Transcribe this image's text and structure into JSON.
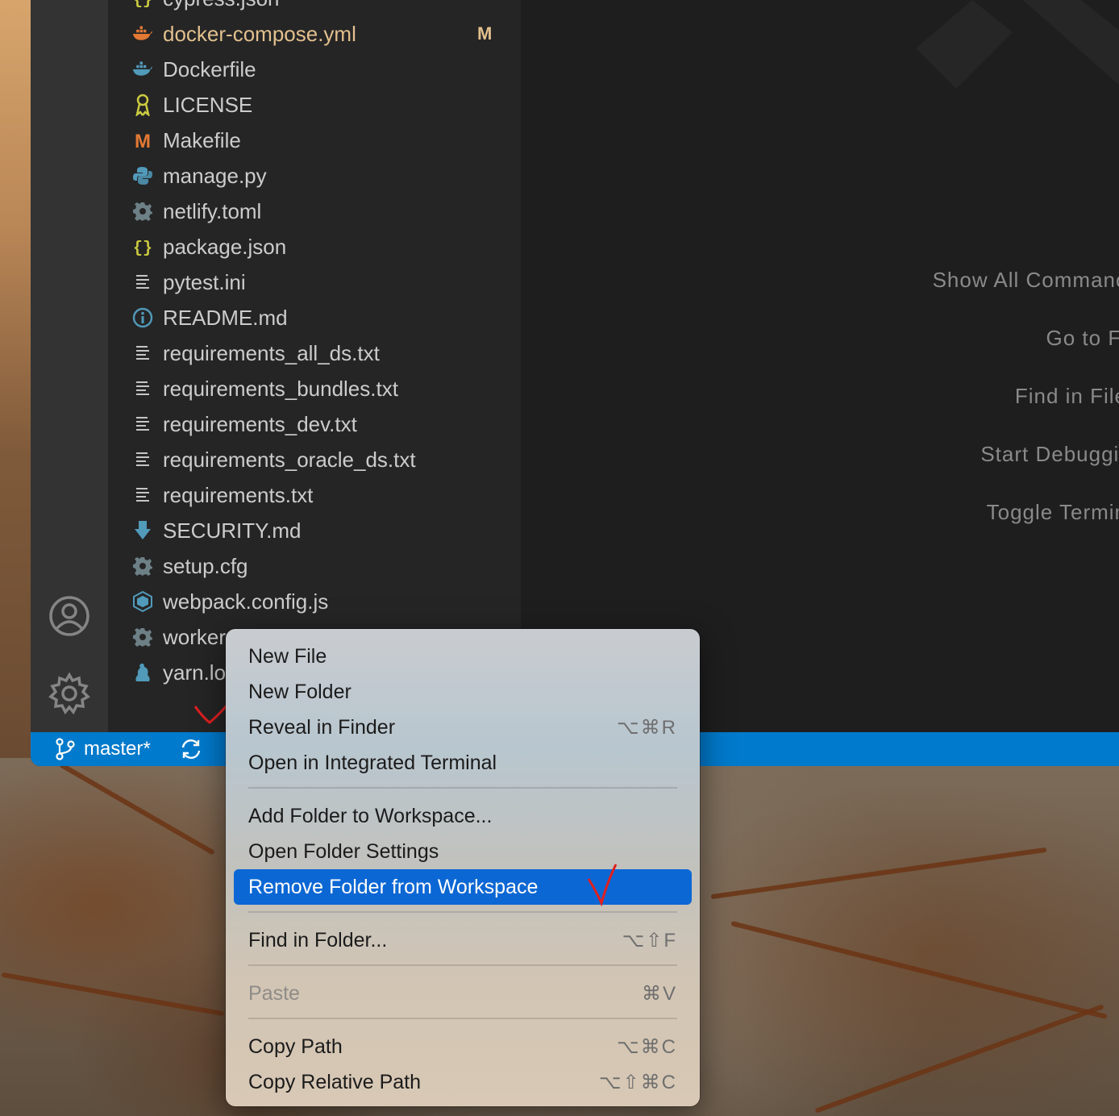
{
  "explorer": {
    "files": [
      {
        "name": "cypress.json",
        "icon": "json-braces-icon",
        "color": "#cbcb41",
        "status": ""
      },
      {
        "name": "docker-compose.yml",
        "icon": "docker-whale-icon",
        "color": "#e37933",
        "status": "M",
        "modified": true
      },
      {
        "name": "Dockerfile",
        "icon": "docker-whale-icon",
        "color": "#519aba",
        "status": ""
      },
      {
        "name": "LICENSE",
        "icon": "license-ribbon-icon",
        "color": "#cbcb41",
        "status": ""
      },
      {
        "name": "Makefile",
        "icon": "makefile-m-icon",
        "color": "#e37933",
        "status": ""
      },
      {
        "name": "manage.py",
        "icon": "python-icon",
        "color": "#519aba",
        "status": ""
      },
      {
        "name": "netlify.toml",
        "icon": "gear-icon",
        "color": "#6d8086",
        "status": ""
      },
      {
        "name": "package.json",
        "icon": "json-braces-icon",
        "color": "#cbcb41",
        "status": ""
      },
      {
        "name": "pytest.ini",
        "icon": "text-lines-icon",
        "color": "#c5c5c5",
        "status": ""
      },
      {
        "name": "README.md",
        "icon": "info-circle-icon",
        "color": "#519aba",
        "status": ""
      },
      {
        "name": "requirements_all_ds.txt",
        "icon": "text-lines-icon",
        "color": "#c5c5c5",
        "status": ""
      },
      {
        "name": "requirements_bundles.txt",
        "icon": "text-lines-icon",
        "color": "#c5c5c5",
        "status": ""
      },
      {
        "name": "requirements_dev.txt",
        "icon": "text-lines-icon",
        "color": "#c5c5c5",
        "status": ""
      },
      {
        "name": "requirements_oracle_ds.txt",
        "icon": "text-lines-icon",
        "color": "#c5c5c5",
        "status": ""
      },
      {
        "name": "requirements.txt",
        "icon": "text-lines-icon",
        "color": "#c5c5c5",
        "status": ""
      },
      {
        "name": "SECURITY.md",
        "icon": "download-arrow-icon",
        "color": "#519aba",
        "status": ""
      },
      {
        "name": "setup.cfg",
        "icon": "gear-icon",
        "color": "#6d8086",
        "status": ""
      },
      {
        "name": "webpack.config.js",
        "icon": "webpack-cube-icon",
        "color": "#519aba",
        "status": ""
      },
      {
        "name": "worker",
        "icon": "gear-icon",
        "color": "#6d8086",
        "status": ""
      },
      {
        "name": "yarn.lo",
        "icon": "yarn-cat-icon",
        "color": "#519aba",
        "status": ""
      }
    ]
  },
  "welcome": {
    "shortcuts": [
      "Show All Commanc",
      "Go to Fi",
      "Find in File",
      "Start Debuggir",
      "Toggle Termin"
    ]
  },
  "statusbar": {
    "branch": "master*"
  },
  "context_menu": {
    "items": [
      {
        "label": "New File",
        "keys": ""
      },
      {
        "label": "New Folder",
        "keys": ""
      },
      {
        "label": "Reveal in Finder",
        "keys": "⌥⌘R"
      },
      {
        "label": "Open in Integrated Terminal",
        "keys": ""
      },
      {
        "label": "Add Folder to Workspace...",
        "keys": ""
      },
      {
        "label": "Open Folder Settings",
        "keys": ""
      },
      {
        "label": "Remove Folder from Workspace",
        "keys": "",
        "selected": true
      },
      {
        "label": "Find in Folder...",
        "keys": "⌥⇧F"
      },
      {
        "label": "Paste",
        "keys": "⌘V",
        "disabled": true
      },
      {
        "label": "Copy Path",
        "keys": "⌥⌘C"
      },
      {
        "label": "Copy Relative Path",
        "keys": "⌥⇧⌘C"
      }
    ]
  },
  "colors": {
    "accent": "#007acc",
    "menu_selected": "#0b67d4",
    "annotation": "#e02020"
  }
}
